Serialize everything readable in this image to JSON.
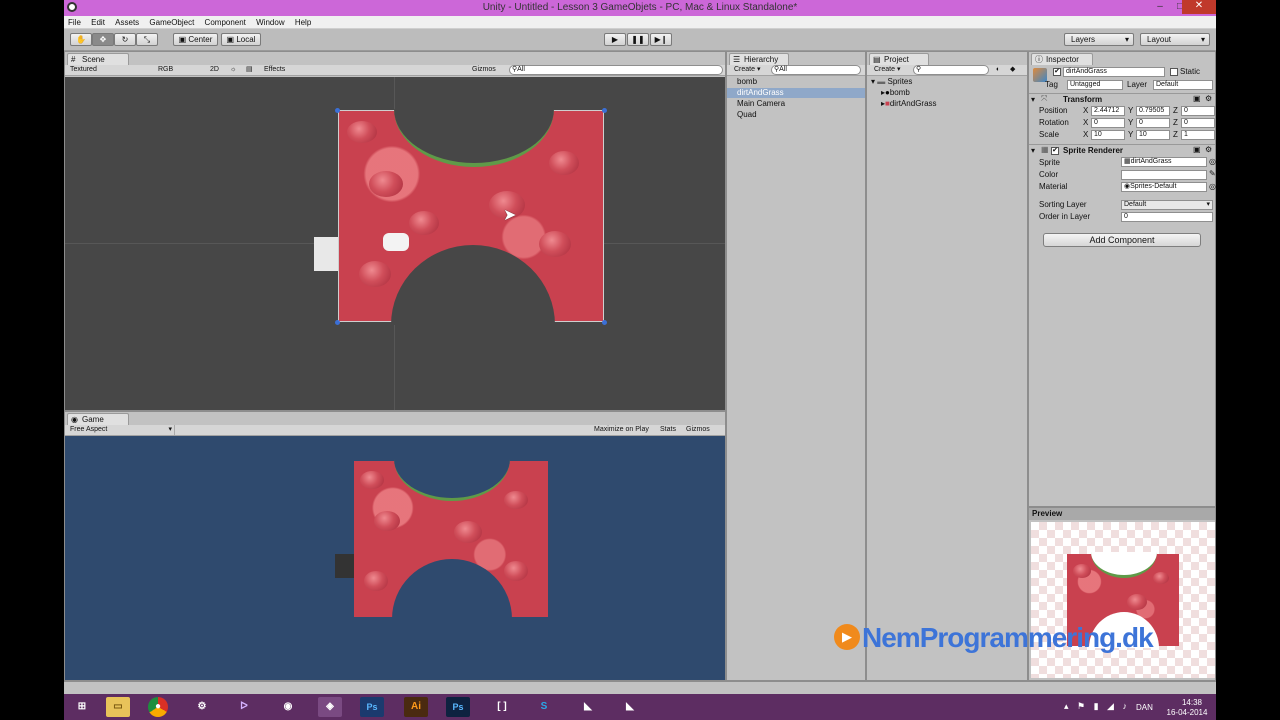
{
  "window": {
    "title": "Unity - Untitled - Lesson 3 GameObjets - PC, Mac & Linux Standalone*",
    "controls": [
      "–",
      "□",
      "✕"
    ]
  },
  "menu": [
    "File",
    "Edit",
    "Assets",
    "GameObject",
    "Component",
    "Window",
    "Help"
  ],
  "toolbar": {
    "pivot": "Center",
    "space": "Local",
    "layers": "Layers",
    "layout": "Layout"
  },
  "scene": {
    "tab": "Scene",
    "render_mode": "Textured",
    "color_mode": "RGB",
    "mode_2d": "2D",
    "effects": "Effects",
    "gizmos": "Gizmos",
    "search": "All"
  },
  "game": {
    "tab": "Game",
    "aspect": "Free Aspect",
    "maximize": "Maximize on Play",
    "stats": "Stats",
    "gizmos": "Gizmos"
  },
  "hierarchy": {
    "tab": "Hierarchy",
    "create": "Create",
    "search": "All",
    "items": [
      "bomb",
      "dirtAndGrass",
      "Main Camera",
      "Quad"
    ],
    "selected": "dirtAndGrass"
  },
  "project": {
    "tab": "Project",
    "create": "Create",
    "folder": "Sprites",
    "items": [
      "bomb",
      "dirtAndGrass"
    ]
  },
  "inspector": {
    "tab": "Inspector",
    "object_name": "dirtAndGrass",
    "static": "Static",
    "tag_label": "Tag",
    "tag": "Untagged",
    "layer_label": "Layer",
    "layer": "Default",
    "transform": {
      "title": "Transform",
      "position_label": "Position",
      "rotation_label": "Rotation",
      "scale_label": "Scale",
      "position": [
        "2.44712",
        "0.79505",
        "0"
      ],
      "rotation": [
        "0",
        "0",
        "0"
      ],
      "scale": [
        "10",
        "10",
        "1"
      ],
      "axis": [
        "X",
        "Y",
        "Z"
      ]
    },
    "sprite_renderer": {
      "title": "Sprite Renderer",
      "sprite_label": "Sprite",
      "sprite": "dirtAndGrass",
      "color_label": "Color",
      "material_label": "Material",
      "material": "Sprites-Default",
      "sorting_layer_label": "Sorting Layer",
      "sorting_layer": "Default",
      "order_label": "Order in Layer",
      "order": "0"
    },
    "add_component": "Add Component"
  },
  "preview": {
    "title": "Preview"
  },
  "watermark": "NemProgrammering.dk",
  "taskbar": {
    "apps": [
      "windows",
      "explorer",
      "chrome",
      "steam",
      "visual-studio",
      "obs",
      "unity",
      "photoshop",
      "illustrator",
      "photoshop",
      "brackets",
      "skype",
      "inkscape",
      "inkscape2"
    ],
    "language": "DAN",
    "time": "14:38",
    "date": "16-04-2014"
  },
  "colors": {
    "titlebar": "#cc67d8",
    "game_bg": "#2f4a6e",
    "scene_bg": "#474747",
    "sprite_red": "#c9414f",
    "grass_green": "#5f9a48",
    "selection": "#8fa8c9",
    "taskbar": "#5d2d62"
  }
}
